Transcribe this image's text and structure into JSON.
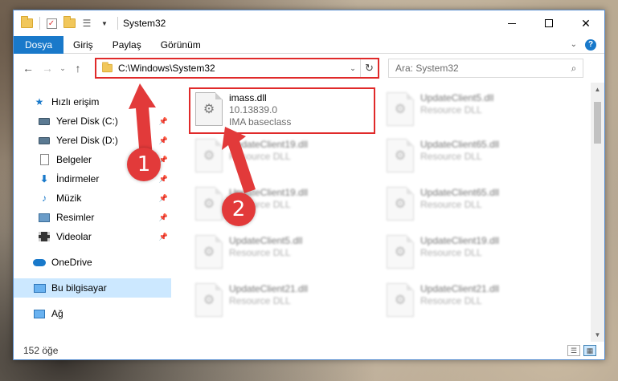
{
  "window": {
    "title": "System32"
  },
  "ribbon": {
    "tabs": [
      "Dosya",
      "Giriş",
      "Paylaş",
      "Görünüm"
    ]
  },
  "address": {
    "path": "C:\\Windows\\System32",
    "search_placeholder": "Ara: System32"
  },
  "nav": {
    "items": [
      {
        "label": "Hızlı erişim",
        "icon": "star-icon"
      },
      {
        "label": "Yerel Disk (C:)",
        "icon": "drive-icon",
        "pinned": true
      },
      {
        "label": "Yerel Disk (D:)",
        "icon": "drive-icon",
        "pinned": true
      },
      {
        "label": "Belgeler",
        "icon": "document-icon",
        "pinned": true
      },
      {
        "label": "İndirmeler",
        "icon": "download-icon",
        "pinned": true
      },
      {
        "label": "Müzik",
        "icon": "music-icon",
        "pinned": true
      },
      {
        "label": "Resimler",
        "icon": "pictures-icon",
        "pinned": true
      },
      {
        "label": "Videolar",
        "icon": "videos-icon",
        "pinned": true
      },
      {
        "label": "OneDrive",
        "icon": "cloud-icon"
      },
      {
        "label": "Bu bilgisayar",
        "icon": "computer-icon",
        "selected": true
      },
      {
        "label": "Ağ",
        "icon": "network-icon"
      }
    ]
  },
  "files": {
    "col1": [
      {
        "name": "imass.dll",
        "line2": "10.13839.0",
        "line3": "IMA baseclass"
      },
      {
        "name": "UpdateClient19.dll",
        "line2": "Resource DLL"
      },
      {
        "name": "UpdateClient19.dll",
        "line2": "Resource DLL"
      },
      {
        "name": "UpdateClient5.dll",
        "line2": "Resource DLL"
      },
      {
        "name": "UpdateClient21.dll",
        "line2": "Resource DLL"
      }
    ],
    "col2": [
      {
        "name": "UpdateClient5.dll",
        "line2": "Resource DLL"
      },
      {
        "name": "UpdateClient65.dll",
        "line2": "Resource DLL"
      },
      {
        "name": "UpdateClient65.dll",
        "line2": "Resource DLL"
      },
      {
        "name": "UpdateClient19.dll",
        "line2": "Resource DLL"
      },
      {
        "name": "UpdateClient21.dll",
        "line2": "Resource DLL"
      }
    ]
  },
  "status": {
    "count": "152 öğe"
  },
  "annotations": {
    "badge1": "1",
    "badge2": "2",
    "color": "#e23a3a"
  }
}
